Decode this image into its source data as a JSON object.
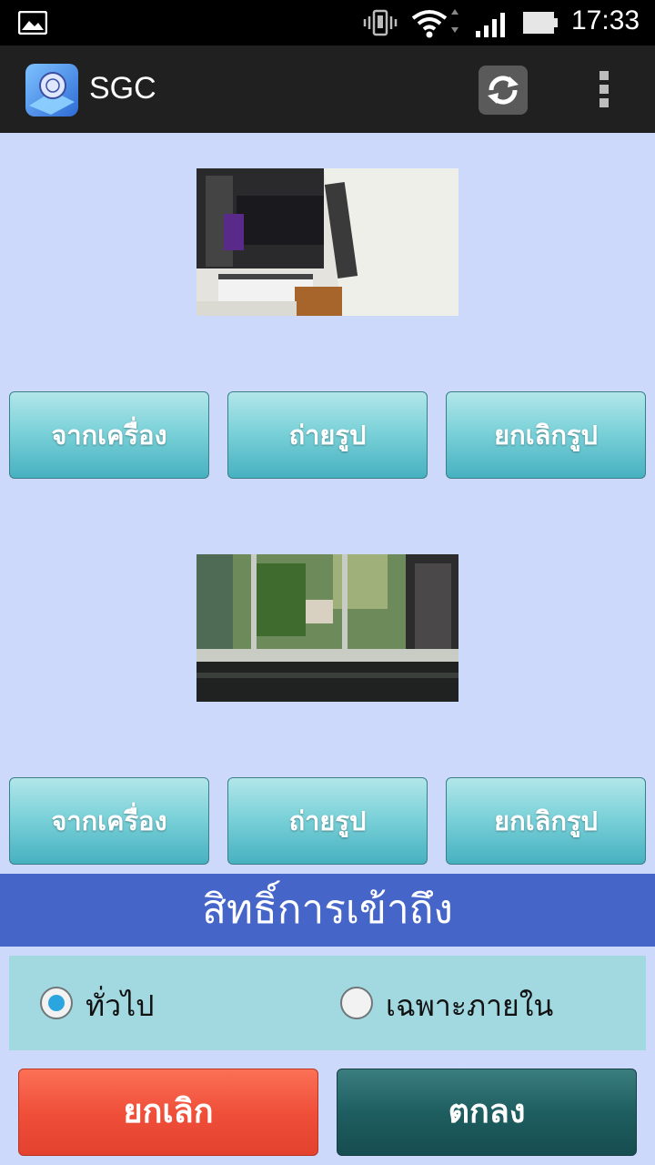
{
  "status_bar": {
    "time": "17:33"
  },
  "app": {
    "title": "SGC"
  },
  "icons": {
    "gallery": "gallery-icon",
    "vibrate": "vibrate-icon",
    "wifi": "wifi-icon",
    "signal": "signal-icon",
    "battery": "battery-icon",
    "sync": "sync-icon",
    "overflow": "overflow-menu-icon"
  },
  "photo_slots": [
    {
      "from_device": "จากเครื่อง",
      "take_photo": "ถ่ายรูป",
      "cancel_photo": "ยกเลิกรูป"
    },
    {
      "from_device": "จากเครื่อง",
      "take_photo": "ถ่ายรูป",
      "cancel_photo": "ยกเลิกรูป"
    }
  ],
  "access": {
    "title": "สิทธิ์การเข้าถึง",
    "options": [
      {
        "label": "ทั่วไป",
        "checked": true
      },
      {
        "label": "เฉพาะภายใน",
        "checked": false
      }
    ]
  },
  "actions": {
    "cancel": "ยกเลิก",
    "ok": "ตกลง"
  },
  "colors": {
    "background": "#cdd9fb",
    "header_blue": "#4565c9",
    "teal_button": "#46b1c0",
    "cancel_red": "#f0503a",
    "ok_teal": "#1e5e60"
  }
}
